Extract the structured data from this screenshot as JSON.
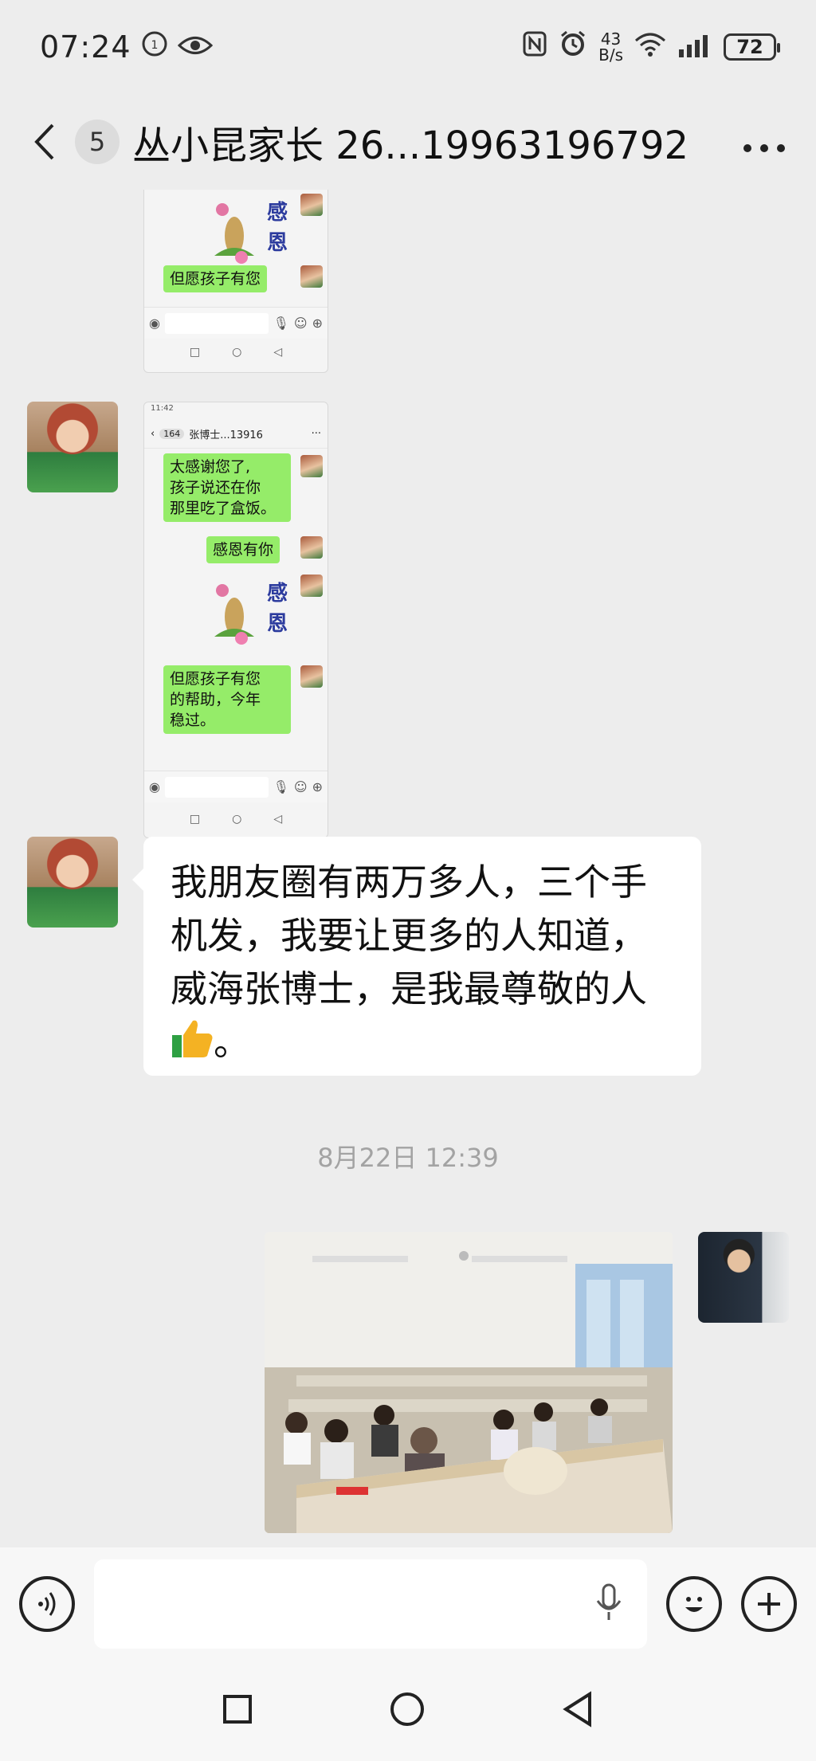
{
  "status_bar": {
    "time": "07:24",
    "net_speed_top": "43",
    "net_speed_bottom": "B/s",
    "battery": "72"
  },
  "nav": {
    "unread_count": "5",
    "title": "丛小昆家长  26...19963196792"
  },
  "messages": {
    "screenshot_1": {
      "bubble_partial": "但愿孩子有您",
      "sticker_chars": [
        "感",
        "恩"
      ]
    },
    "screenshot_2": {
      "mini_time": "11:42",
      "mini_badge": "164",
      "mini_title": "张博士...13916",
      "msg1": "太感谢您了,\n孩子说还在你\n那里吃了盒饭。",
      "msg2": "感恩有你",
      "sticker_chars": [
        "感",
        "恩"
      ],
      "msg3": "但愿孩子有您\n的帮助，今年\n稳过。"
    },
    "text_message": "我朋友圈有两万多人，三个手机发，我要让更多的人知道，威海张博士，是我最尊敬的人",
    "text_message_end": "。",
    "timestamp": "8月22日 12:39"
  },
  "input_bar": {
    "voice_icon": "voice-icon",
    "mic_icon": "microphone-icon",
    "emoji_icon": "emoji-icon",
    "plus_icon": "plus-icon"
  },
  "colors": {
    "background": "#ededed",
    "bubble_green": "#95ec69",
    "bubble_white": "#ffffff",
    "timestamp_gray": "#a3a3a3"
  }
}
